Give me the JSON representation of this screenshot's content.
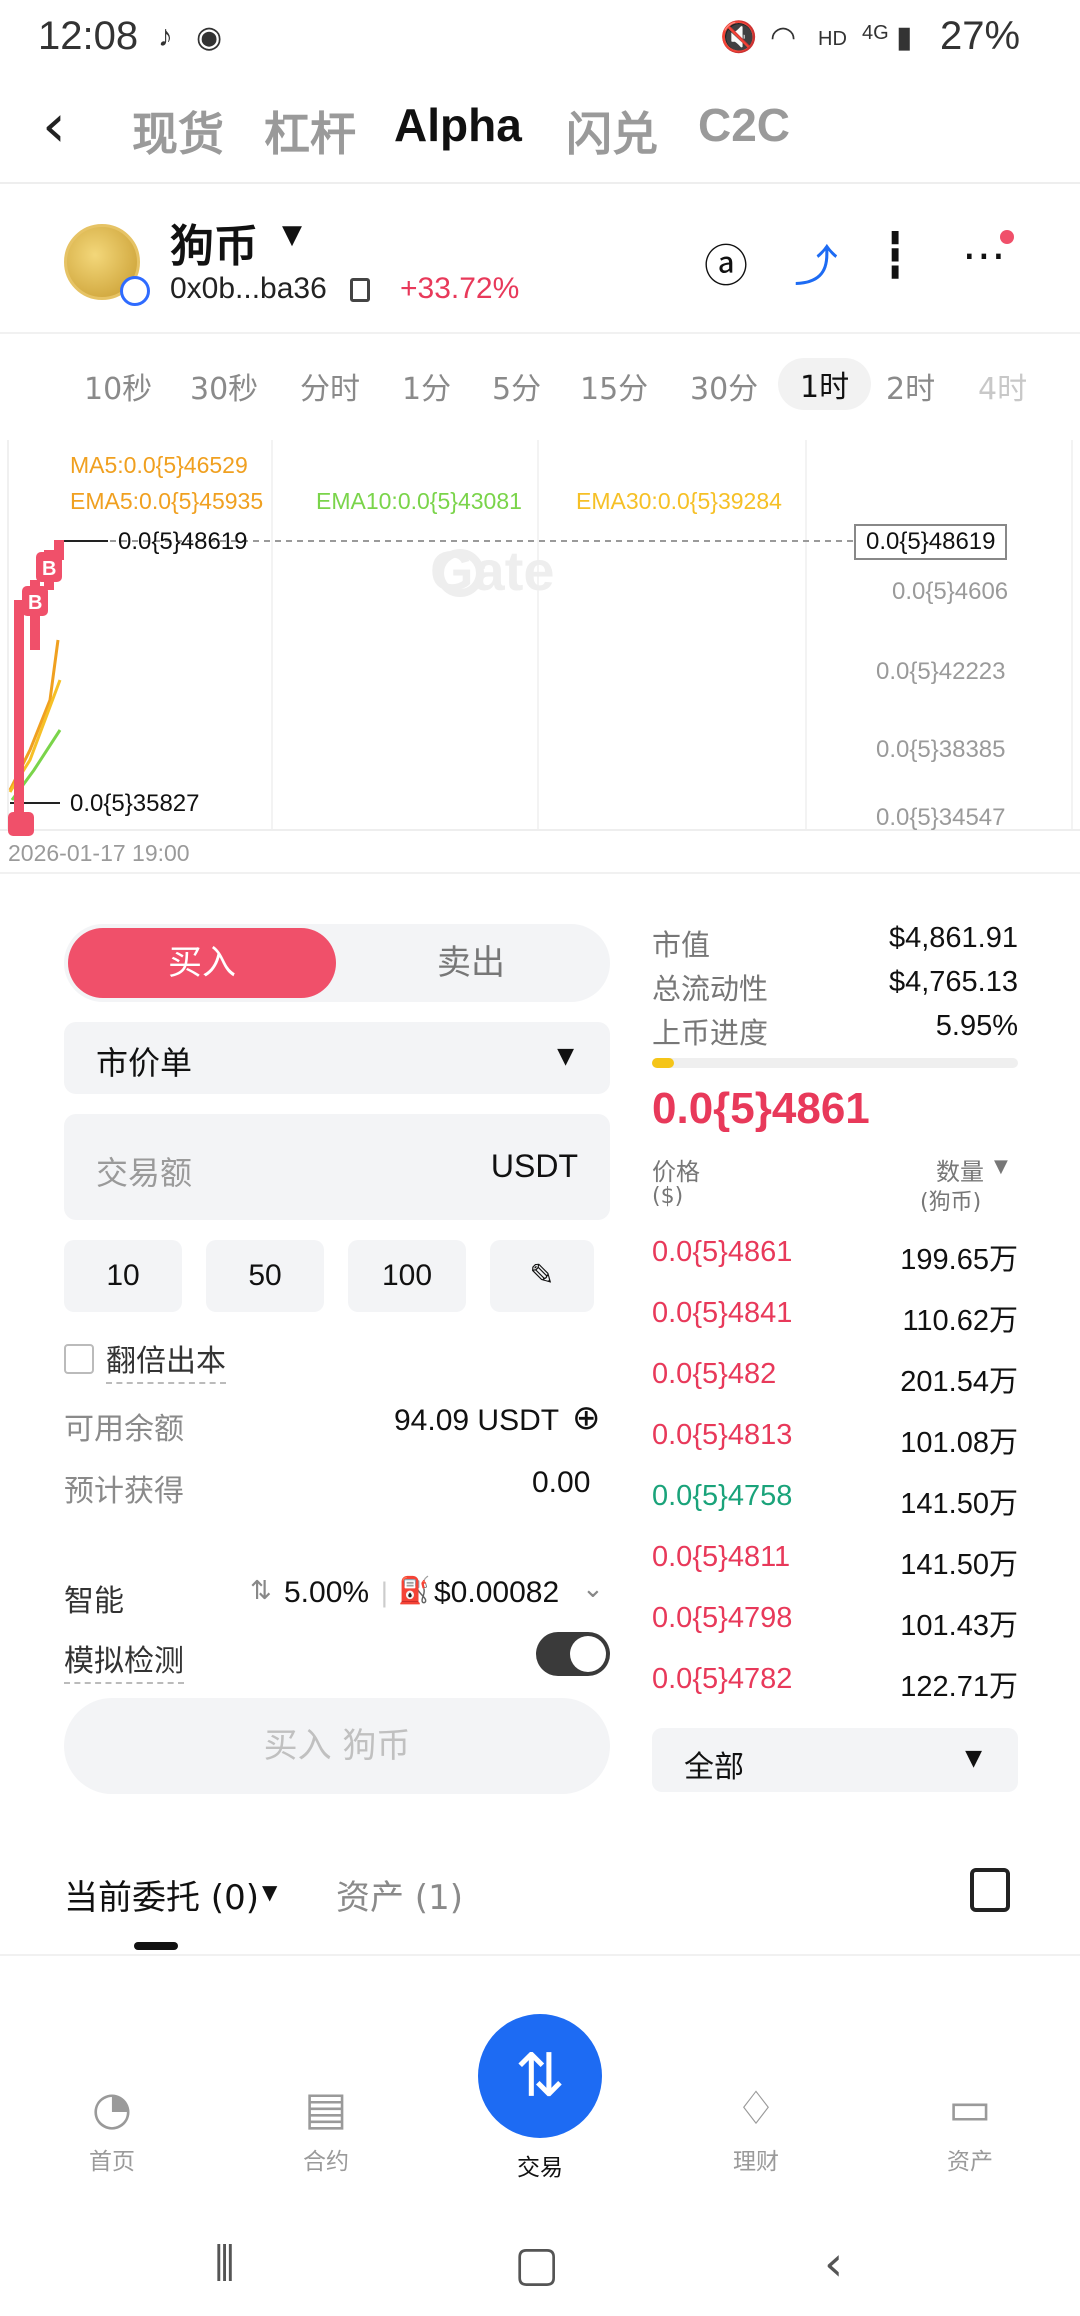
{
  "status_bar": {
    "time": "12:08",
    "network": "HD",
    "network2": "4G",
    "battery": "27%"
  },
  "nav": {
    "tabs": [
      {
        "label": "现货"
      },
      {
        "label": "杠杆"
      },
      {
        "label": "Alpha"
      },
      {
        "label": "闪兑"
      },
      {
        "label": "C2C"
      }
    ],
    "active": "Alpha"
  },
  "token": {
    "name": "狗币",
    "address": "0x0b...ba36",
    "change": "+33.72%"
  },
  "timeframes": [
    "10秒",
    "30秒",
    "分时",
    "1分",
    "5分",
    "15分",
    "30分",
    "1时",
    "2时",
    "4时"
  ],
  "active_timeframe": "1时",
  "chart": {
    "ma5": "MA5:0.0{5}46529",
    "ema5": "EMA5:0.0{5}45935",
    "ema10": "EMA10:0.0{5}43081",
    "ema30": "EMA30:0.0{5}39284",
    "high_label": "0.0{5}48619",
    "low_label": "0.0{5}35827",
    "current_price_tag": "0.0{5}48619",
    "y_ticks": [
      "0.0{5}4606",
      "0.0{5}42223",
      "0.0{5}38385",
      "0.0{5}34547"
    ],
    "watermark": "Gate",
    "timestamp": "2026-01-17 19:00",
    "marker": "B"
  },
  "order_form": {
    "buy_label": "买入",
    "sell_label": "卖出",
    "order_type": "市价单",
    "amount_placeholder": "交易额",
    "amount_unit": "USDT",
    "quick_amounts": [
      "10",
      "50",
      "100"
    ],
    "double_label": "翻倍出本",
    "available_label": "可用余额",
    "available_value": "94.09 USDT",
    "estimate_label": "预计获得",
    "estimate_value": "0.00",
    "smart_label": "智能",
    "slippage": "5.00%",
    "fee": "$0.00082",
    "simulate_label": "模拟检测",
    "submit_label": "买入 狗币"
  },
  "market_info": {
    "mcap_label": "市值",
    "mcap_value": "$4,861.91",
    "liquidity_label": "总流动性",
    "liquidity_value": "$4,765.13",
    "progress_label": "上币进度",
    "progress_value": "5.95%",
    "progress_fraction": 0.0595,
    "price": "0.0{5}4861",
    "col_price": "价格",
    "col_price_unit": "($)",
    "col_qty": "数量",
    "col_qty_unit": "(狗币)"
  },
  "orderbook": [
    {
      "price": "0.0{5}4861",
      "qty": "199.65万",
      "side": "sell"
    },
    {
      "price": "0.0{5}4841",
      "qty": "110.62万",
      "side": "sell"
    },
    {
      "price": "0.0{5}482",
      "qty": "201.54万",
      "side": "sell"
    },
    {
      "price": "0.0{5}4813",
      "qty": "101.08万",
      "side": "sell"
    },
    {
      "price": "0.0{5}4758",
      "qty": "141.50万",
      "side": "buy"
    },
    {
      "price": "0.0{5}4811",
      "qty": "141.50万",
      "side": "sell"
    },
    {
      "price": "0.0{5}4798",
      "qty": "101.43万",
      "side": "sell"
    },
    {
      "price": "0.0{5}4782",
      "qty": "122.71万",
      "side": "sell"
    }
  ],
  "orderbook_filter": "全部",
  "order_tabs": {
    "current": "当前委托 (0)",
    "assets": "资产 (1)"
  },
  "bottom_nav": {
    "home": "首页",
    "futures": "合约",
    "trade": "交易",
    "earn": "理财",
    "assets": "资产"
  },
  "colors": {
    "up": "#e8395a",
    "down": "#1aa37a",
    "accent": "#1d6bf3",
    "progress": "#f5c518"
  }
}
